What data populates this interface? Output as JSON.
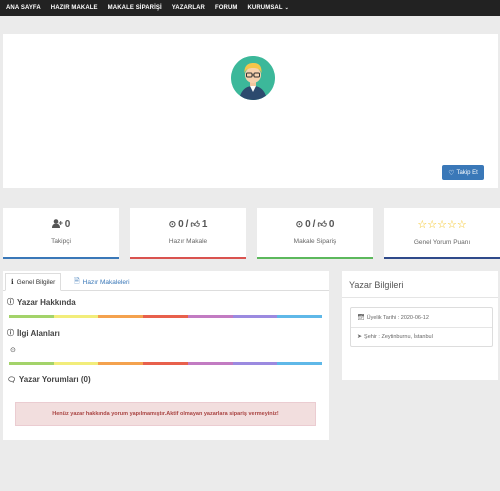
{
  "nav": {
    "items": [
      "ANA SAYFA",
      "HAZIR MAKALE",
      "MAKALE SİPARİŞİ",
      "YAZARLAR",
      "FORUM",
      "KURUMSAL"
    ],
    "dropdown_icon": "chevron-down-icon"
  },
  "profile": {
    "avatar_icon": "user-avatar-icon",
    "follow_label": "Takip Et"
  },
  "stats": [
    {
      "value": "0",
      "label": "Takipçi",
      "icon": "user-plus-icon",
      "color": "#3a78b8"
    },
    {
      "value": "0 / 1",
      "label": "Hazır Makale",
      "icon": "clock-thumbs-up-icon",
      "color": "#d9534f"
    },
    {
      "value": "0 / 0",
      "label": "Makale Sipariş",
      "icon": "clock-thumbs-up-icon",
      "color": "#5cb85c"
    },
    {
      "value": "",
      "label": "Genel Yorum Puanı",
      "icon": "star-icon",
      "color": "#2f4a8a",
      "stars_filled": 0,
      "stars_total": 5
    }
  ],
  "tabs": {
    "general": "Genel Bilgiler",
    "articles": "Hazır Makaleleri"
  },
  "sections": {
    "about": "Yazar Hakkında",
    "interests": "İlgi Alanları",
    "comments": "Yazar Yorumları (0)"
  },
  "alert_text": "Henüz yazar hakkında yorum yapılmamıştır.Aktif olmayan yazarlara sipariş vermeyiniz!",
  "sidebar": {
    "title": "Yazar Bilgileri",
    "member_date": "Üyelik Tarihi : 2020-06-12",
    "city": "Şehir : Zeytinburnu, İstanbul"
  },
  "rainbow_colors": [
    "#a3d36a",
    "#f2ed7a",
    "#f4a24e",
    "#e8604c",
    "#c27bc2",
    "#9b8ae0",
    "#5fb8e8"
  ]
}
